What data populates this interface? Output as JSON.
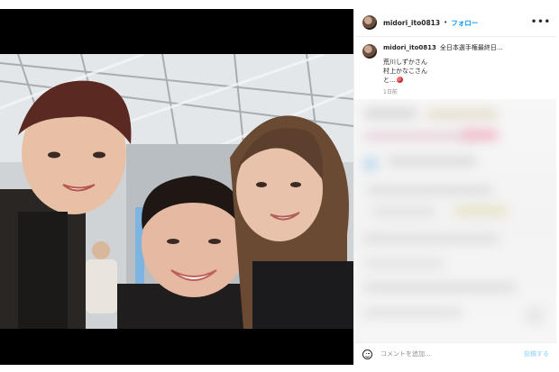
{
  "post": {
    "username": "midori_ito0813",
    "separator": "•",
    "follow_label": "フォロー",
    "more_label": "•••",
    "caption": {
      "username": "midori_ito0813",
      "lines": [
        "全日本選手権最終日…",
        "荒川しずかさん",
        "村上かなこさん",
        "と…"
      ],
      "timestamp": "1日前"
    },
    "comment_placeholder": "コメントを追加...",
    "post_button": "投稿する"
  },
  "icons": {
    "avatar": "profile-avatar",
    "more": "more-options-icon",
    "emoji": "emoji-smile-icon",
    "heart_emoji": "red-heart-emoji"
  },
  "colors": {
    "accent": "#0095f6",
    "post_disabled": "#b2dffc",
    "muted": "#8e8e8e"
  }
}
